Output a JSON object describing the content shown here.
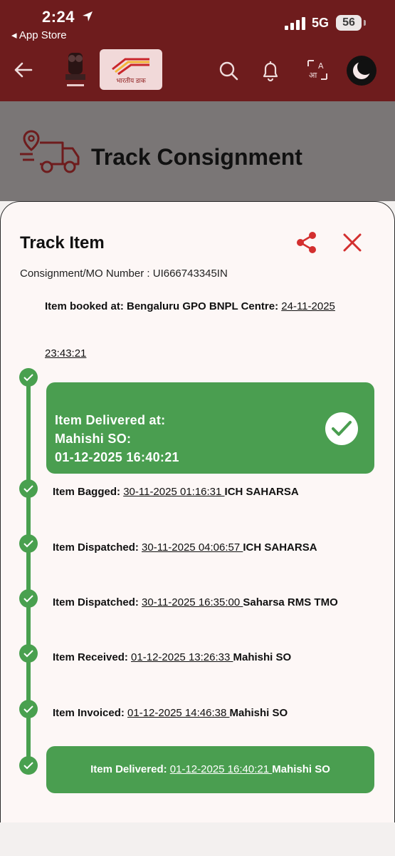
{
  "status_bar": {
    "time": "2:24",
    "back_to_app": "◂ App Store",
    "network": "5G",
    "battery": "56"
  },
  "app_bar": {
    "logo_caption": "भारतीय डाक"
  },
  "page": {
    "title": "Track Consignment"
  },
  "sheet": {
    "title": "Track Item",
    "consignment": "Consignment/MO Number : UI666743345IN",
    "booked_label": "Item booked at: Bengaluru  GPO BNPL Centre: ",
    "booked_date": "24-11-2025",
    "booked_time": "23:43:21",
    "delivered_card": {
      "line1": "Item Delivered at:",
      "line2": "Mahishi SO:",
      "line3": "01-12-2025 16:40:21"
    },
    "events": [
      {
        "label": "Item Bagged: ",
        "datetime": "30-11-2025 01:16:31 ",
        "office": "ICH SAHARSA"
      },
      {
        "label": "Item Dispatched: ",
        "datetime": "30-11-2025 04:06:57 ",
        "office": "ICH SAHARSA"
      },
      {
        "label": "Item Dispatched: ",
        "datetime": "30-11-2025 16:35:00 ",
        "office": "Saharsa RMS TMO"
      },
      {
        "label": "Item Received: ",
        "datetime": "01-12-2025 13:26:33 ",
        "office": "Mahishi SO"
      },
      {
        "label": "Item Invoiced: ",
        "datetime": "01-12-2025 14:46:38 ",
        "office": "Mahishi SO"
      }
    ],
    "final": {
      "label": "Item Delivered: ",
      "datetime": "01-12-2025 16:40:21 ",
      "office": "Mahishi SO"
    }
  },
  "icons": [
    "back-arrow-icon",
    "search-icon",
    "bell-icon",
    "translate-icon",
    "dark-mode-icon",
    "share-icon",
    "close-icon",
    "check-icon",
    "truck-icon",
    "location-arrow-icon",
    "signal-icon"
  ],
  "colors": {
    "header": "#6e1c1d",
    "accent_red": "#d32f2f",
    "timeline_green": "#49a04f",
    "sheet_bg": "#fdf7f6"
  }
}
